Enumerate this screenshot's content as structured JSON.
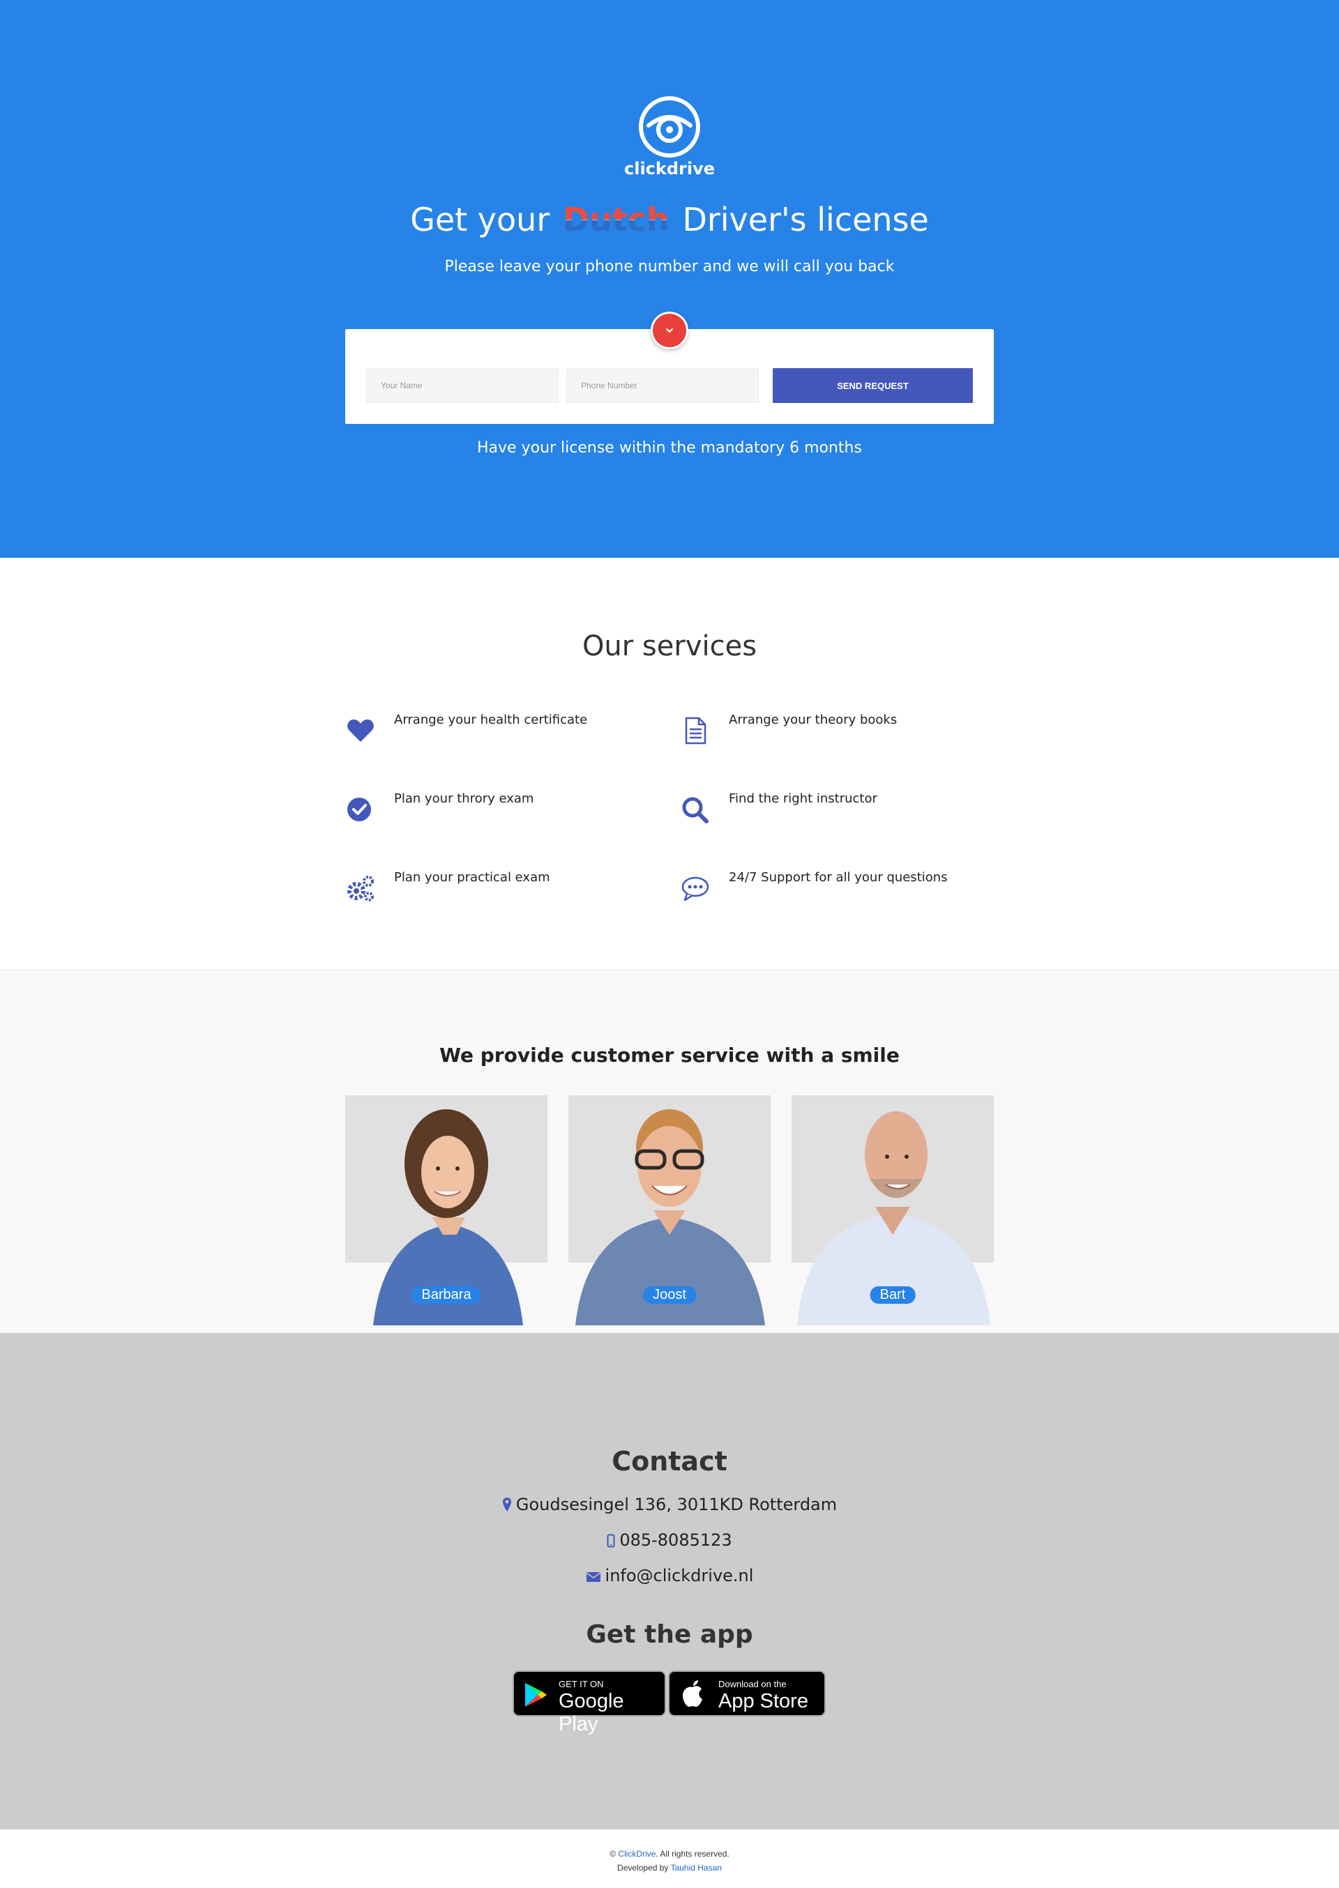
{
  "brand": {
    "name": "clickdrive",
    "logo_icon": "clickdrive-logo-icon",
    "primary_color": "#2783e8",
    "accent_color": "#4458bb",
    "cta_color": "#e9403b"
  },
  "hero": {
    "title_prefix": "Get your",
    "title_highlight": "Dutch",
    "title_suffix": "Driver's license",
    "subtitle": "Please leave your phone number and we will call you back",
    "form": {
      "name_placeholder": "Your Name",
      "phone_placeholder": "Phone Number",
      "submit_label": "SEND REQUEST"
    },
    "note": "Have your license within the mandatory 6 months"
  },
  "services": {
    "title": "Our services",
    "items": [
      {
        "icon": "heart-icon",
        "label": "Arrange your health certificate"
      },
      {
        "icon": "document-icon",
        "label": "Arrange your theory books"
      },
      {
        "icon": "check-circle-icon",
        "label": "Plan your throry exam"
      },
      {
        "icon": "search-icon",
        "label": "Find the right instructor"
      },
      {
        "icon": "gears-icon",
        "label": "Plan your practical exam"
      },
      {
        "icon": "chat-bubble-icon",
        "label": "24/7 Support for all your questions"
      }
    ]
  },
  "team": {
    "title": "We provide customer service with a smile",
    "members": [
      {
        "name": "Barbara"
      },
      {
        "name": "Joost"
      },
      {
        "name": "Bart"
      }
    ]
  },
  "contact": {
    "title": "Contact",
    "address": "Goudsesingel 136, 3011KD Rotterdam",
    "phone": "085-8085123",
    "email": "info@clickdrive.nl",
    "app_title": "Get the app",
    "google_play": {
      "small": "GET IT ON",
      "big": "Google Play"
    },
    "app_store": {
      "small": "Download on the",
      "big": "App Store"
    }
  },
  "footer": {
    "copyright_symbol": "©",
    "brand_link": "ClickDrive",
    "rights": ". All rights reserved.",
    "developed_by": "Developed by",
    "developer": "Tauhid Hasan"
  }
}
